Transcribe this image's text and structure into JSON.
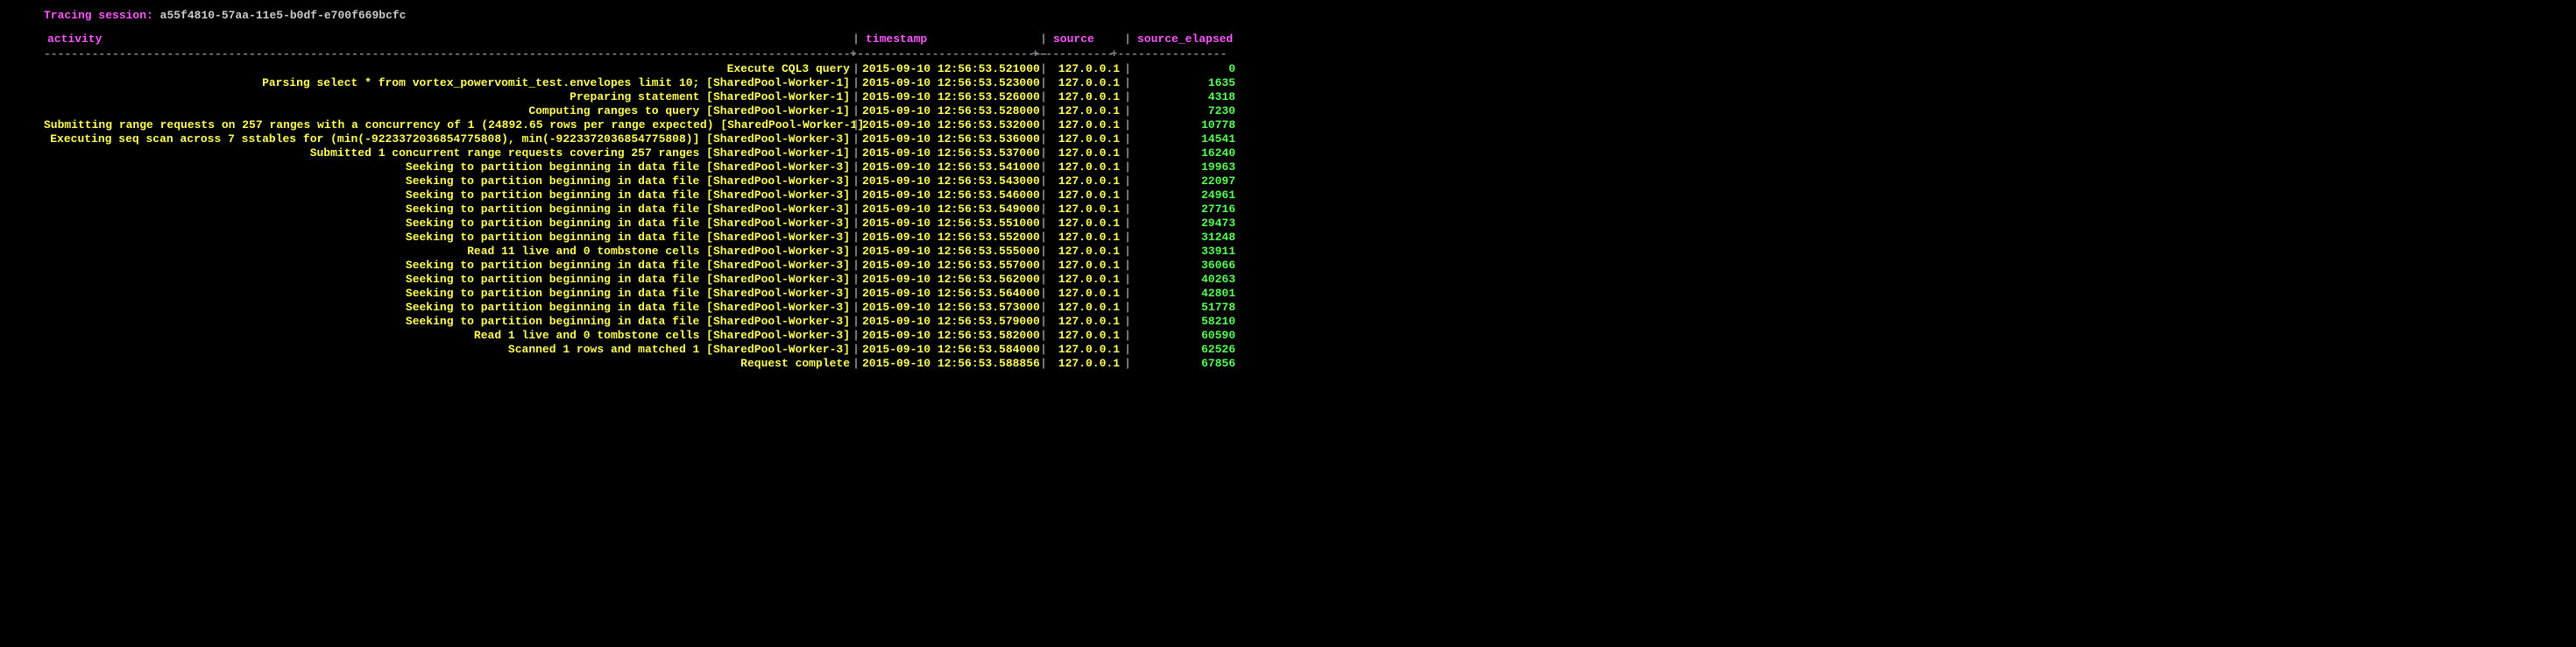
{
  "session": {
    "label": "Tracing session:",
    "id": "a55f4810-57aa-11e5-b0df-e700f669bcfc"
  },
  "headers": {
    "activity": "activity",
    "timestamp": "timestamp",
    "source": "source",
    "elapsed": "source_elapsed"
  },
  "divider": {
    "activity": "-------------------------------------------------------------------------------------------------------------------------------",
    "timestamp": "----------------------------",
    "source": "-----------",
    "elapsed": "----------------"
  },
  "rows": [
    {
      "activity": "Execute CQL3 query",
      "timestamp": "2015-09-10 12:56:53.521000",
      "source": "127.0.0.1",
      "elapsed": "0"
    },
    {
      "activity": "Parsing select * from vortex_powervomit_test.envelopes limit 10; [SharedPool-Worker-1]",
      "timestamp": "2015-09-10 12:56:53.523000",
      "source": "127.0.0.1",
      "elapsed": "1635"
    },
    {
      "activity": "Preparing statement [SharedPool-Worker-1]",
      "timestamp": "2015-09-10 12:56:53.526000",
      "source": "127.0.0.1",
      "elapsed": "4318"
    },
    {
      "activity": "Computing ranges to query [SharedPool-Worker-1]",
      "timestamp": "2015-09-10 12:56:53.528000",
      "source": "127.0.0.1",
      "elapsed": "7230"
    },
    {
      "activity": "Submitting range requests on 257 ranges with a concurrency of 1 (24892.65 rows per range expected) [SharedPool-Worker-1]",
      "timestamp": "2015-09-10 12:56:53.532000",
      "source": "127.0.0.1",
      "elapsed": "10778"
    },
    {
      "activity": "Executing seq scan across 7 sstables for (min(-9223372036854775808), min(-9223372036854775808)] [SharedPool-Worker-3]",
      "timestamp": "2015-09-10 12:56:53.536000",
      "source": "127.0.0.1",
      "elapsed": "14541"
    },
    {
      "activity": "Submitted 1 concurrent range requests covering 257 ranges [SharedPool-Worker-1]",
      "timestamp": "2015-09-10 12:56:53.537000",
      "source": "127.0.0.1",
      "elapsed": "16240"
    },
    {
      "activity": "Seeking to partition beginning in data file [SharedPool-Worker-3]",
      "timestamp": "2015-09-10 12:56:53.541000",
      "source": "127.0.0.1",
      "elapsed": "19963"
    },
    {
      "activity": "Seeking to partition beginning in data file [SharedPool-Worker-3]",
      "timestamp": "2015-09-10 12:56:53.543000",
      "source": "127.0.0.1",
      "elapsed": "22097"
    },
    {
      "activity": "Seeking to partition beginning in data file [SharedPool-Worker-3]",
      "timestamp": "2015-09-10 12:56:53.546000",
      "source": "127.0.0.1",
      "elapsed": "24961"
    },
    {
      "activity": "Seeking to partition beginning in data file [SharedPool-Worker-3]",
      "timestamp": "2015-09-10 12:56:53.549000",
      "source": "127.0.0.1",
      "elapsed": "27716"
    },
    {
      "activity": "Seeking to partition beginning in data file [SharedPool-Worker-3]",
      "timestamp": "2015-09-10 12:56:53.551000",
      "source": "127.0.0.1",
      "elapsed": "29473"
    },
    {
      "activity": "Seeking to partition beginning in data file [SharedPool-Worker-3]",
      "timestamp": "2015-09-10 12:56:53.552000",
      "source": "127.0.0.1",
      "elapsed": "31248"
    },
    {
      "activity": "Read 11 live and 0 tombstone cells [SharedPool-Worker-3]",
      "timestamp": "2015-09-10 12:56:53.555000",
      "source": "127.0.0.1",
      "elapsed": "33911"
    },
    {
      "activity": "Seeking to partition beginning in data file [SharedPool-Worker-3]",
      "timestamp": "2015-09-10 12:56:53.557000",
      "source": "127.0.0.1",
      "elapsed": "36066"
    },
    {
      "activity": "Seeking to partition beginning in data file [SharedPool-Worker-3]",
      "timestamp": "2015-09-10 12:56:53.562000",
      "source": "127.0.0.1",
      "elapsed": "40263"
    },
    {
      "activity": "Seeking to partition beginning in data file [SharedPool-Worker-3]",
      "timestamp": "2015-09-10 12:56:53.564000",
      "source": "127.0.0.1",
      "elapsed": "42801"
    },
    {
      "activity": "Seeking to partition beginning in data file [SharedPool-Worker-3]",
      "timestamp": "2015-09-10 12:56:53.573000",
      "source": "127.0.0.1",
      "elapsed": "51778"
    },
    {
      "activity": "Seeking to partition beginning in data file [SharedPool-Worker-3]",
      "timestamp": "2015-09-10 12:56:53.579000",
      "source": "127.0.0.1",
      "elapsed": "58210"
    },
    {
      "activity": "Read 1 live and 0 tombstone cells [SharedPool-Worker-3]",
      "timestamp": "2015-09-10 12:56:53.582000",
      "source": "127.0.0.1",
      "elapsed": "60590"
    },
    {
      "activity": "Scanned 1 rows and matched 1 [SharedPool-Worker-3]",
      "timestamp": "2015-09-10 12:56:53.584000",
      "source": "127.0.0.1",
      "elapsed": "62526"
    },
    {
      "activity": "Request complete",
      "timestamp": "2015-09-10 12:56:53.588856",
      "source": "127.0.0.1",
      "elapsed": "67856"
    }
  ]
}
